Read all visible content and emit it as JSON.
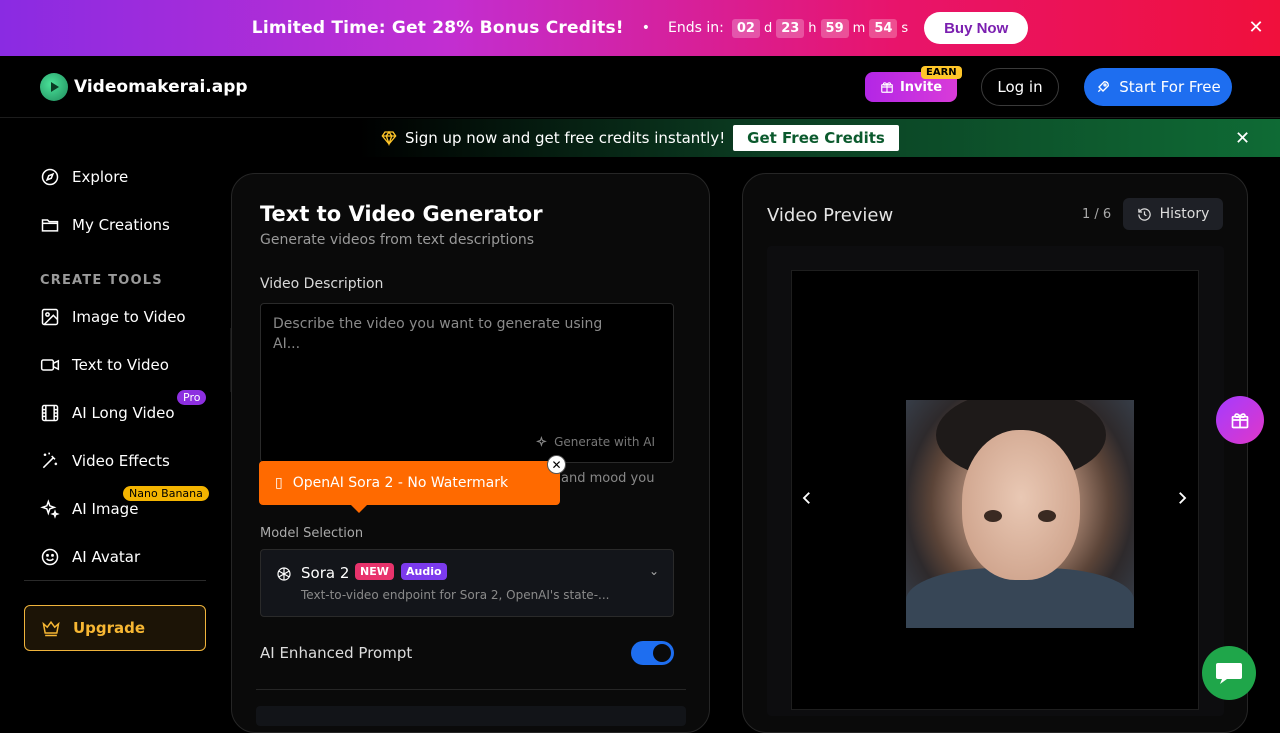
{
  "promo": {
    "title": "Limited Time: Get 28% Bonus Credits!",
    "dot": "•",
    "ends_label": "Ends in:",
    "countdown": [
      {
        "value": "02",
        "unit": "d"
      },
      {
        "value": "23",
        "unit": "h"
      },
      {
        "value": "59",
        "unit": "m"
      },
      {
        "value": "54",
        "unit": "s"
      }
    ],
    "buy_label": "Buy Now",
    "close_glyph": "✕"
  },
  "header": {
    "logo_text": "Videomakerai.app",
    "invite_label": "Invite",
    "earn_label": "EARN",
    "login_label": "Log in",
    "start_label": "Start For Free"
  },
  "signup": {
    "text": "Sign up now and get free credits instantly!",
    "button_label": "Get Free Credits",
    "close_glyph": "✕"
  },
  "sidebar": {
    "explore": "Explore",
    "my_creations": "My Creations",
    "section_title": "CREATE TOOLS",
    "items": [
      {
        "label": "Image to Video"
      },
      {
        "label": "Text to Video"
      },
      {
        "label": "AI Long Video",
        "badge": "Pro"
      },
      {
        "label": "Video Effects"
      },
      {
        "label": "AI Image",
        "badge": "Nano Banana"
      },
      {
        "label": "AI Avatar"
      }
    ],
    "upgrade_label": "Upgrade"
  },
  "panel": {
    "title": "Text to Video Generator",
    "subtitle": "Generate videos from text descriptions",
    "desc_label": "Video Description",
    "desc_placeholder": "Describe the video you want to generate using AI...",
    "gen_ai_label": "Generate with AI",
    "hint_text": "and mood you",
    "tip_text": "OpenAI Sora 2 - No Watermark",
    "tip_icon": "▯",
    "model_label": "Model Selection",
    "model_name": "Sora 2",
    "tag_new": "NEW",
    "tag_audio": "Audio",
    "model_desc": "Text-to-video endpoint for Sora 2, OpenAI's state-...",
    "toggle_label": "AI Enhanced Prompt",
    "toggle_on": true
  },
  "preview": {
    "title": "Video Preview",
    "count": "1 / 6",
    "history_label": "History"
  },
  "colors": {
    "accent_blue": "#1e6ef0",
    "upgrade_gold": "#f7b733",
    "tip_orange": "#ff6a00"
  }
}
